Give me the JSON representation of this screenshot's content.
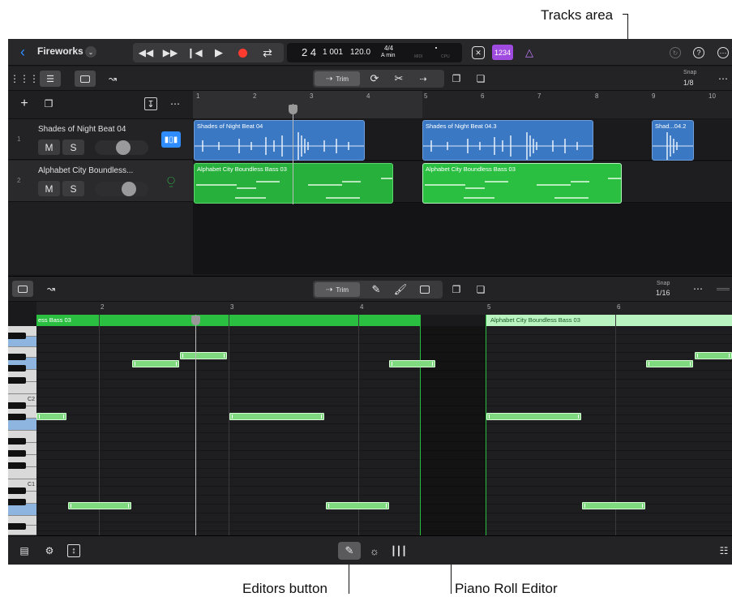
{
  "callouts": {
    "tracks_area": "Tracks area",
    "editors_button": "Editors button",
    "piano_roll_editor": "Piano Roll Editor"
  },
  "control_bar": {
    "project_name": "Fireworks",
    "lcd": {
      "position_bar": "2 4",
      "position_sub": "1 001",
      "tempo": "120.0",
      "time_signature": "4/4",
      "key": "A min",
      "midi_label": "MIDI",
      "cpu_label": "CPU"
    },
    "count_in_label": "1234"
  },
  "tracks_toolbar": {
    "trim_label": "Trim",
    "snap_label": "Snap",
    "snap_value": "1/8"
  },
  "tracks_ruler": [
    "1",
    "2",
    "3",
    "4",
    "5",
    "6",
    "7",
    "8",
    "9",
    "10"
  ],
  "tracks": [
    {
      "number": "1",
      "name": "Shades of Night Beat 04",
      "mute": "M",
      "solo": "S"
    },
    {
      "number": "2",
      "name": "Alphabet City Boundless...",
      "mute": "M",
      "solo": "S"
    }
  ],
  "regions": {
    "audio_1": "Shades of Night Beat 04",
    "audio_2": "Shades of Night Beat 04.3",
    "audio_3": "Shad...04.2",
    "midi_1": "Alphabet City Boundless Bass 03",
    "midi_2": "Alphabet City Boundless Bass 03"
  },
  "piano_roll_toolbar": {
    "trim_label": "Trim",
    "snap_label": "Snap",
    "snap_value": "1/16"
  },
  "piano_roll_ruler": [
    "2",
    "3",
    "4",
    "5",
    "6"
  ],
  "piano_roll_regions": {
    "left": "ess Bass 03",
    "right": "Alphabet City Boundless Bass 03"
  },
  "keyboard_labels": [
    "C2",
    "C1"
  ],
  "colors": {
    "audio_region": "#3a78c4",
    "midi_region": "#27b03c",
    "record": "#ff3b30",
    "count_in": "#a04be0",
    "accent_blue": "#2f8cff"
  }
}
